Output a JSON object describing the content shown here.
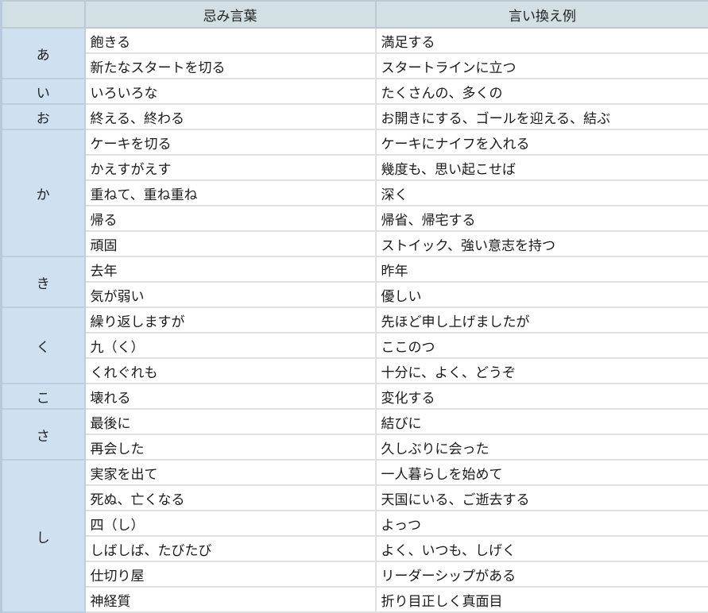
{
  "header": {
    "col_key": "",
    "col_taboo": "忌み言葉",
    "col_alt": "言い換え例"
  },
  "groups": [
    {
      "key": "あ",
      "rows": [
        {
          "taboo": "飽きる",
          "alt": "満足する"
        },
        {
          "taboo": "新たなスタートを切る",
          "alt": "スタートラインに立つ"
        }
      ]
    },
    {
      "key": "い",
      "rows": [
        {
          "taboo": "いろいろな",
          "alt": "たくさんの、多くの"
        }
      ]
    },
    {
      "key": "お",
      "rows": [
        {
          "taboo": "終える、終わる",
          "alt": "お開きにする、ゴールを迎える、結ぶ"
        }
      ]
    },
    {
      "key": "か",
      "rows": [
        {
          "taboo": "ケーキを切る",
          "alt": "ケーキにナイフを入れる"
        },
        {
          "taboo": "かえすがえす",
          "alt": "幾度も、思い起こせば"
        },
        {
          "taboo": "重ねて、重ね重ね",
          "alt": "深く"
        },
        {
          "taboo": "帰る",
          "alt": "帰省、帰宅する"
        },
        {
          "taboo": "頑固",
          "alt": "ストイック、強い意志を持つ"
        }
      ]
    },
    {
      "key": "き",
      "rows": [
        {
          "taboo": "去年",
          "alt": "昨年"
        },
        {
          "taboo": "気が弱い",
          "alt": "優しい"
        }
      ]
    },
    {
      "key": "く",
      "rows": [
        {
          "taboo": "繰り返しますが",
          "alt": "先ほど申し上げましたが"
        },
        {
          "taboo": "九（く）",
          "alt": "ここのつ"
        },
        {
          "taboo": "くれぐれも",
          "alt": "十分に、よく、どうぞ"
        }
      ]
    },
    {
      "key": "こ",
      "rows": [
        {
          "taboo": "壊れる",
          "alt": "変化する"
        }
      ]
    },
    {
      "key": "さ",
      "rows": [
        {
          "taboo": "最後に",
          "alt": "結びに"
        },
        {
          "taboo": "再会した",
          "alt": "久しぶりに会った"
        }
      ]
    },
    {
      "key": "し",
      "rows": [
        {
          "taboo": "実家を出て",
          "alt": "一人暮らしを始めて"
        },
        {
          "taboo": "死ぬ、亡くなる",
          "alt": "天国にいる、ご逝去する"
        },
        {
          "taboo": "四（し）",
          "alt": "よっつ"
        },
        {
          "taboo": "しばしば、たびたび",
          "alt": "よく、いつも、しげく"
        },
        {
          "taboo": "仕切り屋",
          "alt": "リーダーシップがある"
        },
        {
          "taboo": "神経質",
          "alt": "折り目正しく真面目"
        }
      ]
    }
  ]
}
